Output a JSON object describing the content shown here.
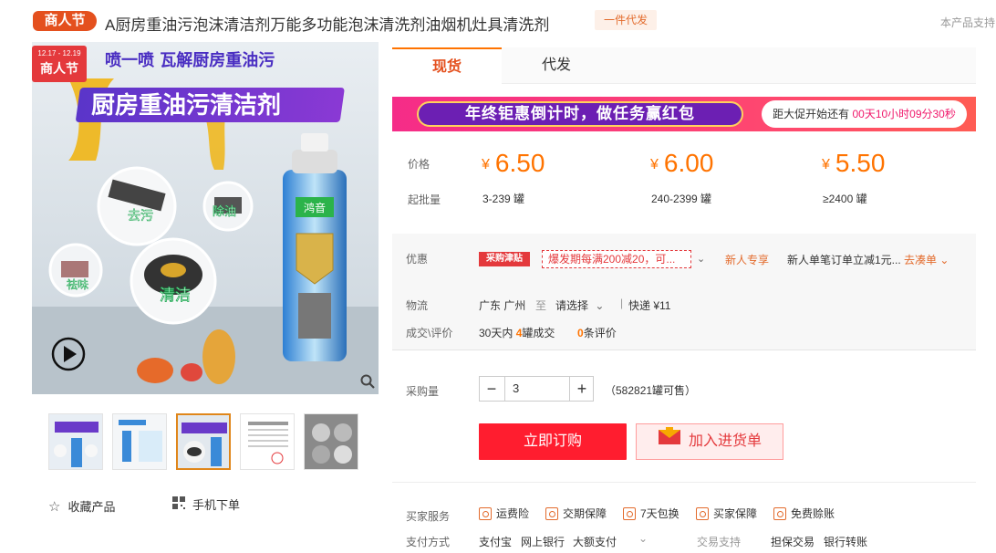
{
  "header": {
    "festival_badge": "商人节",
    "title": "A厨房重油污泡沫清洁剂万能多功能泡沫清洗剂油烟机灶具清洗剂",
    "dropship_tag": "一件代发",
    "right_text": "本产品支持"
  },
  "gallery": {
    "main_image": {
      "date_badge": "12.17 - 12.19",
      "festival_badge": "商人节",
      "slogan": "喷一喷 瓦解厨房重油污",
      "banner": "厨房重油污清洁剂",
      "bubbles": [
        "去污",
        "除油",
        "祛味",
        "清洁"
      ],
      "can_brand": "鸿音"
    },
    "thumbnail_count": 5,
    "favorite_label": "收藏产品",
    "mobile_order_label": "手机下单"
  },
  "tabs": [
    {
      "label": "现货",
      "active": true
    },
    {
      "label": "代发",
      "active": false
    }
  ],
  "promo": {
    "left_text": "年终钜惠倒计时，做任务赢红包",
    "countdown_prefix": "距大促开始还有",
    "countdown": "00天10小时09分30秒"
  },
  "pricing": {
    "price_label": "价格",
    "qty_label": "起批量",
    "currency": "¥",
    "tiers": [
      {
        "price": "6.50",
        "range": "3-239 罐"
      },
      {
        "price": "6.00",
        "range": "240-2399 罐"
      },
      {
        "price": "5.50",
        "range": "≥2400 罐"
      }
    ]
  },
  "discount": {
    "label": "优惠",
    "logo": "采购津贴",
    "coupon_text": "爆发期每满200减20，可...",
    "newbie_label": "新人专享",
    "newbie_desc": "新人单笔订单立减1元...",
    "newbie_link": "去凑单"
  },
  "logistics": {
    "label": "物流",
    "from": "广东 广州",
    "to_word": "至",
    "to_select": "请选择",
    "shipping": "快递 ¥11"
  },
  "deals": {
    "label": "成交\\评价",
    "prefix": "30天内",
    "count": "4",
    "suffix": "罐成交",
    "reviews_count": "0",
    "reviews_suffix": "条评价"
  },
  "purchase": {
    "qty_label": "采购量",
    "quantity": "3",
    "minus": "−",
    "plus": "+",
    "stock": "（582821罐可售）",
    "order_button": "立即订购",
    "cart_button": "加入进货单"
  },
  "services": {
    "label": "买家服务",
    "items": [
      "运费险",
      "交期保障",
      "7天包换",
      "买家保障",
      "免费赊账"
    ]
  },
  "payment": {
    "label": "支付方式",
    "methods": [
      "支付宝",
      "网上银行",
      "大额支付"
    ],
    "trade_label": "交易支持",
    "trade_items": [
      "担保交易",
      "银行转账"
    ]
  },
  "colors": {
    "accent_orange": "#ff7300",
    "order_red": "#ff1d2f",
    "festival_orange": "#e4501e"
  }
}
